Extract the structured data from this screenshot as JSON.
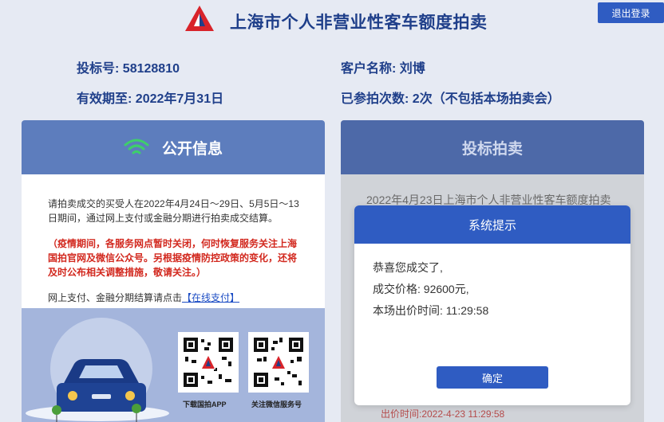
{
  "header": {
    "title": "上海市个人非营业性客车额度拍卖",
    "logout_label": "退出登录"
  },
  "info": {
    "bid_no_label": "投标号:",
    "bid_no": "58128810",
    "valid_label": "有效期至:",
    "valid_date": "2022年7月31日",
    "client_label": "客户名称:",
    "client_name": "刘博",
    "count_label": "已参拍次数:",
    "count_value": "2次（不包括本场拍卖会）"
  },
  "left_panel": {
    "title": "公开信息",
    "notice": "请拍卖成交的买受人在2022年4月24日～29日、5月5日～13日期间，通过网上支付或金融分期进行拍卖成交结算。",
    "notice_red": "（疫情期间，各服务网点暂时关闭，何时恢复服务关注上海国拍官网及微信公众号。另根据疫情防控政策的变化，还将及时公布相关调整措施，敬请关注。）",
    "pay_text": "网上支付、金融分期结算请点击",
    "pay_link": "【在线支付】",
    "qr1_label": "下载国拍APP",
    "qr2_label": "关注微信服务号"
  },
  "right_panel": {
    "title": "投标拍卖",
    "bg_text": "2022年4月23日上海市个人非营业性客车额度拍卖",
    "bid_time": "出价时间:2022-4-23 11:29:58"
  },
  "modal": {
    "title": "系统提示",
    "line1": "恭喜您成交了,",
    "price_label": "成交价格:",
    "price_value": "92600元,",
    "time_label": "本场出价时间:",
    "time_value": "11:29:58",
    "confirm_label": "确定"
  },
  "colors": {
    "brand_blue": "#2f5cc2",
    "panel_blue": "#5d7dbd",
    "red_notice": "#d2281e"
  }
}
